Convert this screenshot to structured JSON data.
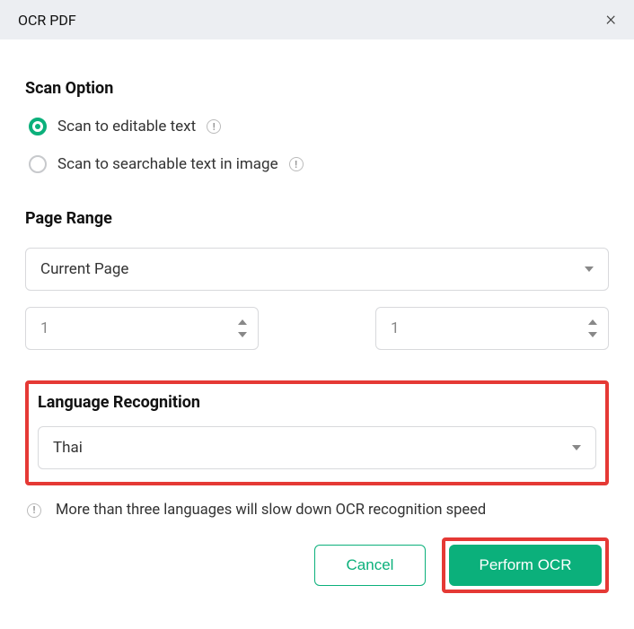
{
  "titlebar": {
    "title": "OCR PDF"
  },
  "scan_option": {
    "header": "Scan Option",
    "options": {
      "editable": "Scan to editable text",
      "searchable": "Scan to searchable text in image"
    }
  },
  "page_range": {
    "header": "Page Range",
    "selected": "Current Page",
    "from": "1",
    "to": "1"
  },
  "language": {
    "header": "Language Recognition",
    "selected": "Thai",
    "warning": "More than three languages will slow down OCR recognition speed"
  },
  "buttons": {
    "cancel": "Cancel",
    "perform": "Perform OCR"
  }
}
